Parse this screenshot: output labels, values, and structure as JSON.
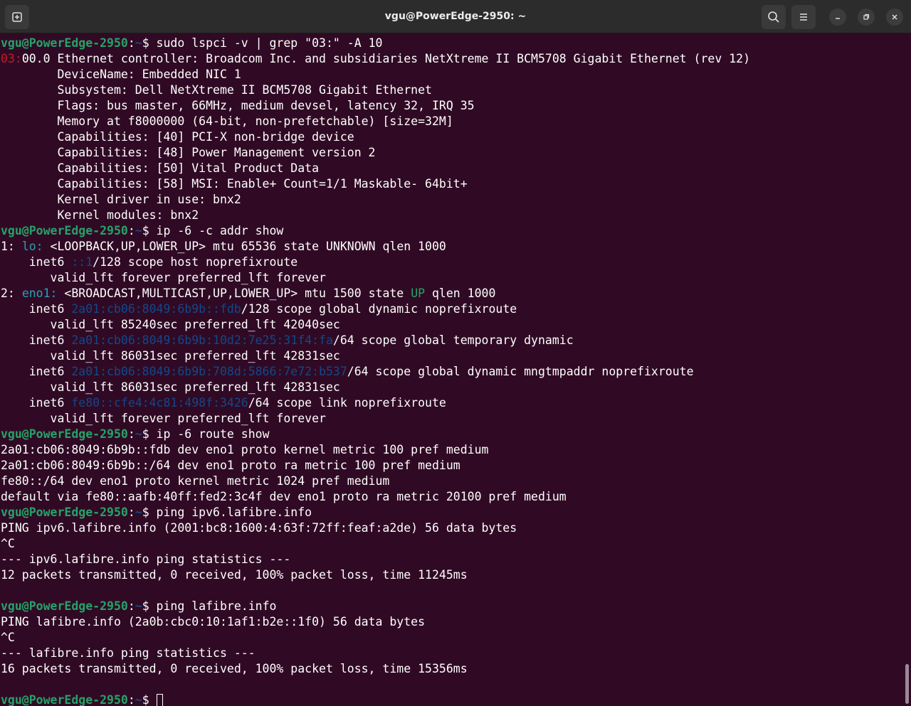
{
  "window": {
    "title": "vgu@PowerEdge-2950: ~"
  },
  "icons": {
    "new_tab": "new-tab-icon",
    "search": "search-icon",
    "menu": "hamburger-menu-icon",
    "minimize": "minimize-icon",
    "maximize": "restore-icon",
    "close": "close-icon"
  },
  "colors": {
    "background": "#300a24",
    "prompt_user": "#26a269",
    "prompt_path": "#12488b",
    "bus_id": "#c01c28",
    "iface": "#2aa1b3",
    "state_up": "#26a269",
    "address": "#12488b"
  },
  "terminal": {
    "lines": [
      [
        {
          "t": "vgu@PowerEdge-2950",
          "c": "pu"
        },
        {
          "t": ":"
        },
        {
          "t": "~",
          "c": "pp"
        },
        {
          "t": "$ sudo lspci -v | grep \"03:\" -A 10"
        }
      ],
      [
        {
          "t": "03:",
          "c": "red"
        },
        {
          "t": "00.0 Ethernet controller: Broadcom Inc. and subsidiaries NetXtreme II BCM5708 Gigabit Ethernet (rev 12)"
        }
      ],
      [
        {
          "t": "        DeviceName: Embedded NIC 1"
        }
      ],
      [
        {
          "t": "        Subsystem: Dell NetXtreme II BCM5708 Gigabit Ethernet"
        }
      ],
      [
        {
          "t": "        Flags: bus master, 66MHz, medium devsel, latency 32, IRQ 35"
        }
      ],
      [
        {
          "t": "        Memory at f8000000 (64-bit, non-prefetchable) [size=32M]"
        }
      ],
      [
        {
          "t": "        Capabilities: [40] PCI-X non-bridge device"
        }
      ],
      [
        {
          "t": "        Capabilities: [48] Power Management version 2"
        }
      ],
      [
        {
          "t": "        Capabilities: [50] Vital Product Data"
        }
      ],
      [
        {
          "t": "        Capabilities: [58] MSI: Enable+ Count=1/1 Maskable- 64bit+"
        }
      ],
      [
        {
          "t": "        Kernel driver in use: bnx2"
        }
      ],
      [
        {
          "t": "        Kernel modules: bnx2"
        }
      ],
      [
        {
          "t": "vgu@PowerEdge-2950",
          "c": "pu"
        },
        {
          "t": ":"
        },
        {
          "t": "~",
          "c": "pp"
        },
        {
          "t": "$ ip -6 -c addr show"
        }
      ],
      [
        {
          "t": "1: "
        },
        {
          "t": "lo:",
          "c": "cyan"
        },
        {
          "t": " <LOOPBACK,UP,LOWER_UP> mtu 65536 state UNKNOWN qlen 1000"
        }
      ],
      [
        {
          "t": "    inet6 "
        },
        {
          "t": "::1",
          "c": "blue"
        },
        {
          "t": "/128 scope host noprefixroute"
        }
      ],
      [
        {
          "t": "       valid_lft forever preferred_lft forever"
        }
      ],
      [
        {
          "t": "2: "
        },
        {
          "t": "eno1:",
          "c": "cyan"
        },
        {
          "t": " <BROADCAST,MULTICAST,UP,LOWER_UP> mtu 1500 state "
        },
        {
          "t": "UP",
          "c": "green"
        },
        {
          "t": " qlen 1000"
        }
      ],
      [
        {
          "t": "    inet6 "
        },
        {
          "t": "2a01:cb06:8049:6b9b::fdb",
          "c": "blue"
        },
        {
          "t": "/128 scope global dynamic noprefixroute"
        }
      ],
      [
        {
          "t": "       valid_lft 85240sec preferred_lft 42040sec"
        }
      ],
      [
        {
          "t": "    inet6 "
        },
        {
          "t": "2a01:cb06:8049:6b9b:10d2:7e25:31f4:fa",
          "c": "blue"
        },
        {
          "t": "/64 scope global temporary dynamic"
        }
      ],
      [
        {
          "t": "       valid_lft 86031sec preferred_lft 42831sec"
        }
      ],
      [
        {
          "t": "    inet6 "
        },
        {
          "t": "2a01:cb06:8049:6b9b:708d:5866:7e72:b537",
          "c": "blue"
        },
        {
          "t": "/64 scope global dynamic mngtmpaddr noprefixroute"
        }
      ],
      [
        {
          "t": "       valid_lft 86031sec preferred_lft 42831sec"
        }
      ],
      [
        {
          "t": "    inet6 "
        },
        {
          "t": "fe80::cfe4:4c81:498f:3426",
          "c": "blue"
        },
        {
          "t": "/64 scope link noprefixroute"
        }
      ],
      [
        {
          "t": "       valid_lft forever preferred_lft forever"
        }
      ],
      [
        {
          "t": "vgu@PowerEdge-2950",
          "c": "pu"
        },
        {
          "t": ":"
        },
        {
          "t": "~",
          "c": "pp"
        },
        {
          "t": "$ ip -6 route show"
        }
      ],
      [
        {
          "t": "2a01:cb06:8049:6b9b::fdb dev eno1 proto kernel metric 100 pref medium"
        }
      ],
      [
        {
          "t": "2a01:cb06:8049:6b9b::/64 dev eno1 proto ra metric 100 pref medium"
        }
      ],
      [
        {
          "t": "fe80::/64 dev eno1 proto kernel metric 1024 pref medium"
        }
      ],
      [
        {
          "t": "default via fe80::aafb:40ff:fed2:3c4f dev eno1 proto ra metric 20100 pref medium"
        }
      ],
      [
        {
          "t": "vgu@PowerEdge-2950",
          "c": "pu"
        },
        {
          "t": ":"
        },
        {
          "t": "~",
          "c": "pp"
        },
        {
          "t": "$ ping ipv6.lafibre.info"
        }
      ],
      [
        {
          "t": "PING ipv6.lafibre.info (2001:bc8:1600:4:63f:72ff:feaf:a2de) 56 data bytes"
        }
      ],
      [
        {
          "t": "^C"
        }
      ],
      [
        {
          "t": "--- ipv6.lafibre.info ping statistics ---"
        }
      ],
      [
        {
          "t": "12 packets transmitted, 0 received, 100% packet loss, time 11245ms"
        }
      ],
      [],
      [
        {
          "t": "vgu@PowerEdge-2950",
          "c": "pu"
        },
        {
          "t": ":"
        },
        {
          "t": "~",
          "c": "pp"
        },
        {
          "t": "$ ping lafibre.info"
        }
      ],
      [
        {
          "t": "PING lafibre.info (2a0b:cbc0:10:1af1:b2e::1f0) 56 data bytes"
        }
      ],
      [
        {
          "t": "^C"
        }
      ],
      [
        {
          "t": "--- lafibre.info ping statistics ---"
        }
      ],
      [
        {
          "t": "16 packets transmitted, 0 received, 100% packet loss, time 15356ms"
        }
      ],
      [],
      [
        {
          "t": "vgu@PowerEdge-2950",
          "c": "pu"
        },
        {
          "t": ":"
        },
        {
          "t": "~",
          "c": "pp"
        },
        {
          "t": "$ "
        }
      ]
    ]
  }
}
